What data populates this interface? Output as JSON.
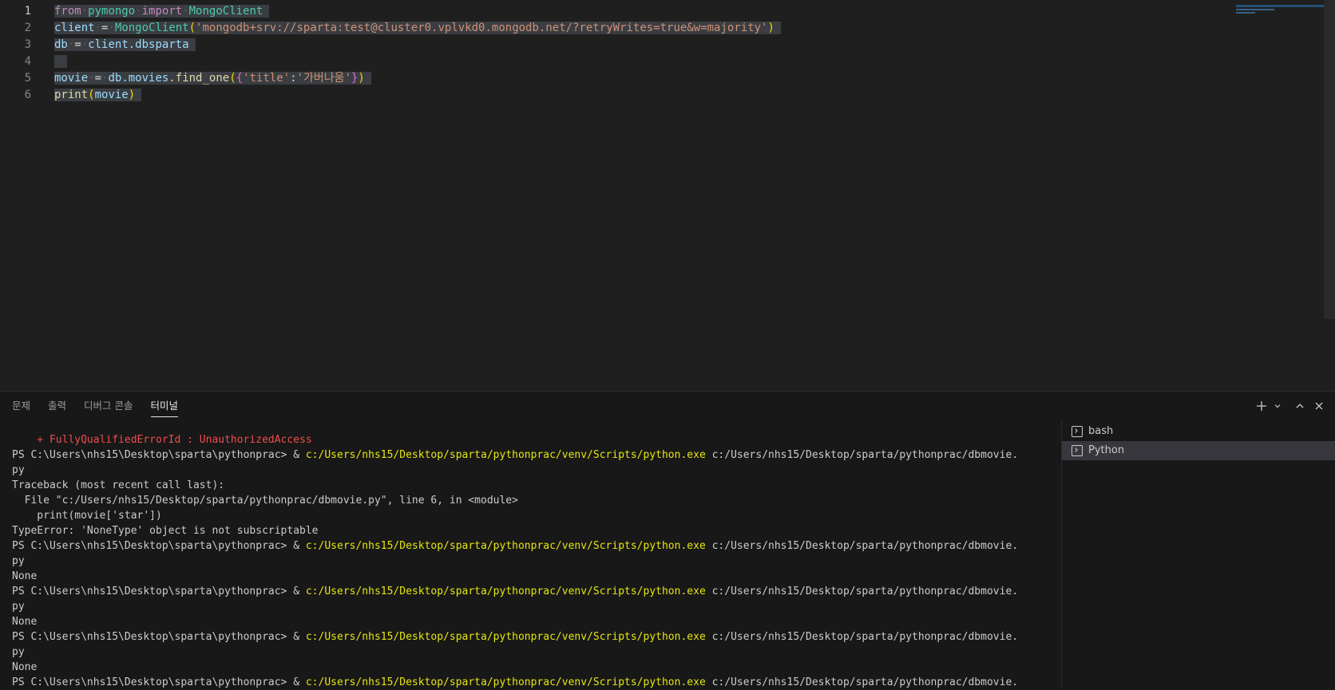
{
  "editor": {
    "line_numbers": [
      "1",
      "2",
      "3",
      "4",
      "5",
      "6"
    ],
    "lines": {
      "l1": {
        "from": "from",
        "mod": "pymongo",
        "import": "import",
        "cls": "MongoClient"
      },
      "l2": {
        "var": "client",
        "eq": "=",
        "fn": "MongoClient",
        "open": "(",
        "str": "'mongodb+srv://sparta:test@cluster0.vplvkd0.mongodb.net/?retryWrites=true&w=majority'",
        "close": ")"
      },
      "l3": {
        "var": "db",
        "eq": "=",
        "obj": "client",
        "attr": ".dbsparta"
      },
      "l5": {
        "var": "movie",
        "eq": "=",
        "obj": "db",
        "attr1": ".movies",
        "attr2": ".find_one",
        "p1": "(",
        "b1": "{",
        "k": "'title'",
        "colon": ":",
        "v": "'가버나움'",
        "b2": "}",
        "p2": ")"
      },
      "l6": {
        "fn": "print",
        "p1": "(",
        "arg": "movie",
        "p2": ")"
      }
    }
  },
  "panel": {
    "tabs": [
      "문제",
      "출력",
      "디버그 콘솔",
      "터미널"
    ],
    "active_tab": "터미널"
  },
  "terminal": {
    "error_line": "    + FullyQualifiedErrorId : UnauthorizedAccess",
    "prompt": "PS C:\\Users\\nhs15\\Desktop\\sparta\\pythonprac> & ",
    "exe": "c:/Users/nhs15/Desktop/sparta/pythonprac/venv/Scripts/python.exe",
    "script": " c:/Users/nhs15/Desktop/sparta/pythonprac/dbmovie.",
    "wrap": "py",
    "traceback": [
      "Traceback (most recent call last):",
      "  File \"c:/Users/nhs15/Desktop/sparta/pythonprac/dbmovie.py\", line 6, in <module>",
      "    print(movie['star'])",
      "TypeError: 'NoneType' object is not subscriptable"
    ],
    "none": "None"
  },
  "terminal_list": [
    "bash",
    "Python"
  ]
}
